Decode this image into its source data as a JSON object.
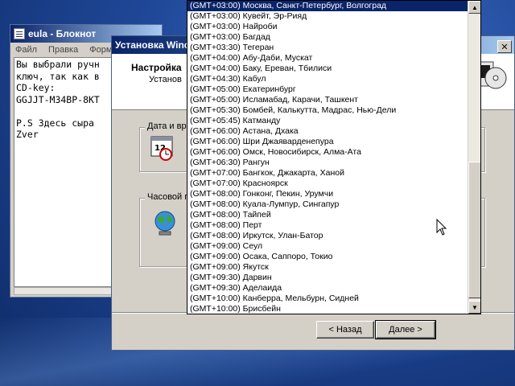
{
  "notepad": {
    "title": "eula - Блокнот",
    "menu": [
      "Файл",
      "Правка",
      "Форма"
    ],
    "text": "Вы выбрали ручн\nключ, так как в\nCD-key:\nGGJJT-M34BP-8KT\n\nP.S Здесь сыра\nZver"
  },
  "setup": {
    "title": "Установка Winc",
    "header_title": "Настройка",
    "header_subtitle": "Установ",
    "group_datetime": "Дата и вр",
    "group_timezone": "Часовой п",
    "back_label": "< Назад",
    "next_label": "Далее >"
  },
  "timezones": [
    "(GMT+03:00) Москва, Санкт-Петербург, Волгоград",
    "(GMT+03:00) Кувейт, Эр-Рияд",
    "(GMT+03:00) Найроби",
    "(GMT+03:00) Багдад",
    "(GMT+03:30) Тегеран",
    "(GMT+04:00) Абу-Даби, Мускат",
    "(GMT+04:00) Баку, Ереван, Тбилиси",
    "(GMT+04:30) Кабул",
    "(GMT+05:00) Екатеринбург",
    "(GMT+05:00) Исламабад, Карачи, Ташкент",
    "(GMT+05:30) Бомбей, Калькутта, Мадрас, Нью-Дели",
    "(GMT+05:45) Катманду",
    "(GMT+06:00) Астана, Дхака",
    "(GMT+06:00) Шри Джаяварденепура",
    "(GMT+06:00) Омск, Новосибирск, Алма-Ата",
    "(GMT+06:30) Рангун",
    "(GMT+07:00) Бангкок, Джакарта, Ханой",
    "(GMT+07:00) Красноярск",
    "(GMT+08:00) Гонконг, Пекин, Урумчи",
    "(GMT+08:00) Куала-Лумпур, Сингапур",
    "(GMT+08:00) Тайпей",
    "(GMT+08:00) Перт",
    "(GMT+08:00) Иркутск, Улан-Батор",
    "(GMT+09:00) Сеул",
    "(GMT+09:00) Осака, Саппоро, Токио",
    "(GMT+09:00) Якутск",
    "(GMT+09:30) Дарвин",
    "(GMT+09:30) Аделаида",
    "(GMT+10:00) Канберра, Мельбурн, Сидней",
    "(GMT+10:00) Брисбейн"
  ],
  "selected_timezone_index": 0,
  "colors": {
    "title_bar": "#0a246a",
    "selection": "#0a246a",
    "window_face": "#d4d0c8"
  }
}
